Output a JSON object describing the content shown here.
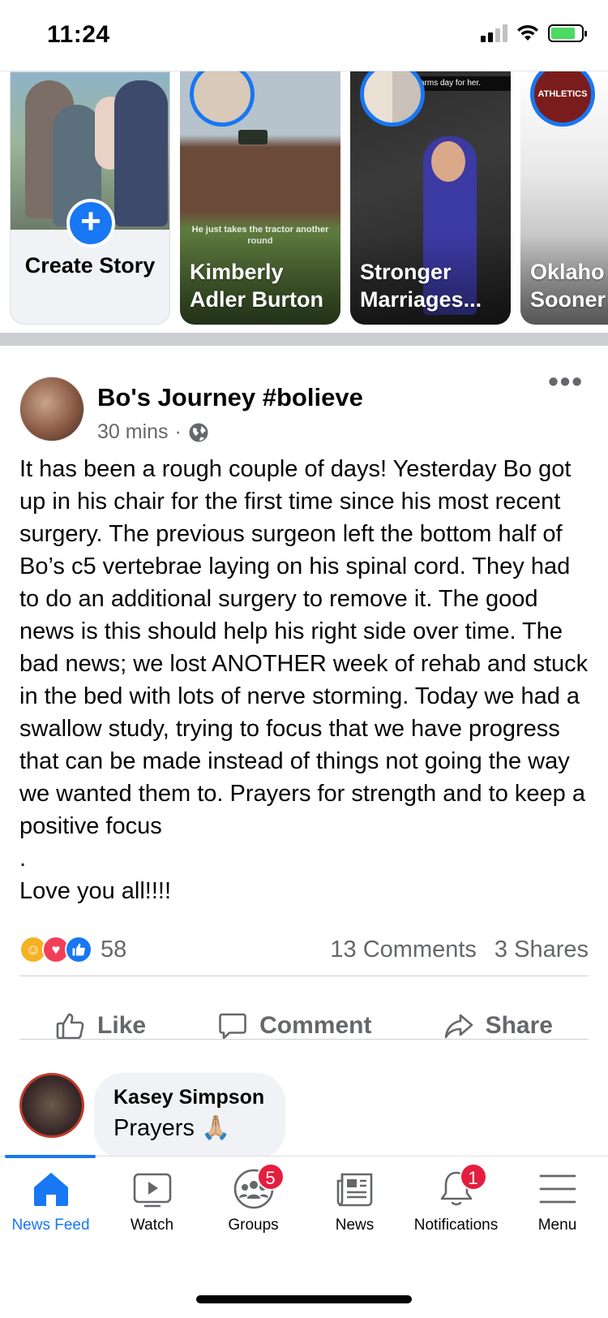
{
  "status_bar": {
    "time": "11:24"
  },
  "stories": {
    "create": {
      "label": "Create Story"
    },
    "items": [
      {
        "name": "Kimberly Adler Burton",
        "overlay": "He just takes the tractor another round"
      },
      {
        "name": "Stronger Marriages...",
        "banner": "arms day for her."
      },
      {
        "name": "Oklaho Sooner",
        "avatar_text": "ATHLETICS"
      }
    ]
  },
  "post": {
    "author": "Bo's Journey #bolieve",
    "time": "30 mins",
    "separator": "·",
    "body_lines": [
      "It has been a rough couple of days!  Yesterday Bo got up in his chair for the first time since his most recent surgery. The previous surgeon left the bottom half of Bo’s c5 vertebrae laying on his spinal cord. They had to do an additional surgery to remove it. The good news is this should help his right side over time. The bad news; we lost ANOTHER week of rehab and stuck in the bed with lots of nerve storming. Today we had a swallow study, trying to focus that we have progress that can be made instead of things not going the way we wanted them to. Prayers for strength and to keep a positive focus",
      ".",
      "Love you all!!!!"
    ],
    "reaction_count": "58",
    "comments_count": "13 Comments",
    "shares_count": "3 Shares",
    "actions": {
      "like": "Like",
      "comment": "Comment",
      "share": "Share"
    }
  },
  "comment": {
    "author": "Kasey Simpson",
    "text": "Prayers 🙏🏼"
  },
  "tab_bar": {
    "tabs": [
      {
        "label": "News Feed",
        "icon": "home-icon",
        "active": true
      },
      {
        "label": "Watch",
        "icon": "watch-icon"
      },
      {
        "label": "Groups",
        "icon": "groups-icon",
        "badge": "5"
      },
      {
        "label": "News",
        "icon": "news-icon"
      },
      {
        "label": "Notifications",
        "icon": "bell-icon",
        "badge": "1"
      },
      {
        "label": "Menu",
        "icon": "menu-icon"
      }
    ]
  },
  "colors": {
    "accent": "#1877f2",
    "badge": "#e41e3f",
    "secondary_text": "#65676b"
  }
}
